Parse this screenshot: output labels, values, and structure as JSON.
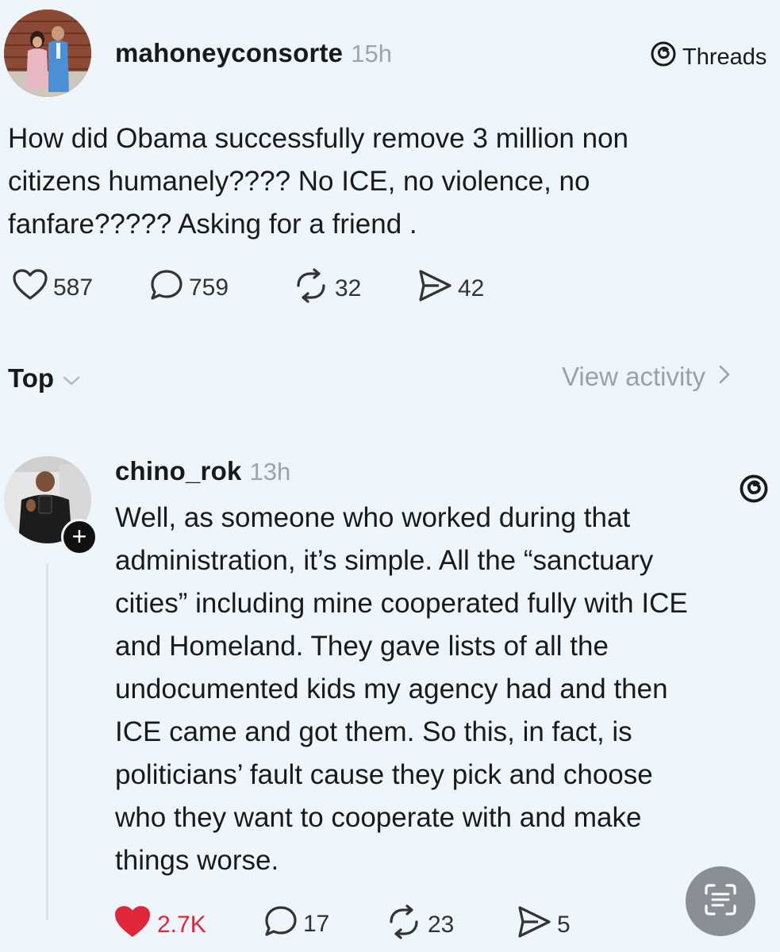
{
  "app": {
    "name": "Threads"
  },
  "post": {
    "username": "mahoneyconsorte",
    "time": "15h",
    "text": [
      "How did Obama successfully remove 3 million non",
      "citizens humanely???? No ICE, no violence, no",
      "fanfare????? Asking for a friend ."
    ],
    "likes": "587",
    "replies": "759",
    "reposts": "32",
    "shares": "42"
  },
  "sort": {
    "label": "Top",
    "view_activity": "View activity"
  },
  "reply": {
    "username": "chino_rok",
    "time": "13h",
    "text": [
      "Well, as someone who worked during that",
      "administration, it’s simple. All the “sanctuary",
      "cities” including mine cooperated fully with ICE",
      "and Homeland. They gave lists of all the",
      "undocumented kids my agency had and then",
      "ICE came and got them. So this, in fact, is",
      "politicians’ fault cause they pick and choose",
      "who they want to cooperate with and make",
      "things worse."
    ],
    "likes": "2.7K",
    "replies": "17",
    "reposts": "23",
    "shares": "5",
    "liked": true
  },
  "colors": {
    "background": "#eef5fb",
    "like_active": "#e0263a",
    "muted_text": "#a0a4a8"
  }
}
